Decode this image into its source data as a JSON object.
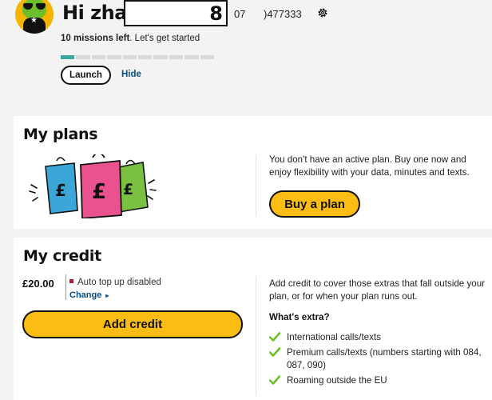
{
  "header": {
    "greeting": "Hi zha",
    "redacted_suffix": "8",
    "phone_prefix": "07",
    "phone_rest": ")477333",
    "missions_count": "10 missions left",
    "missions_suffix": ". Let's get started",
    "progress": {
      "completed": 1,
      "total": 10
    },
    "launch_label": "Launch",
    "hide_label": "Hide"
  },
  "plans": {
    "title": "My plans",
    "description": "You don't have an active plan. Buy one now and enjoy flexibility with your data, minutes and texts.",
    "buy_label": "Buy a plan"
  },
  "credit": {
    "title": "My credit",
    "amount": "£20.00",
    "topup_status": "Auto top up disabled",
    "change_label": "Change",
    "add_label": "Add credit",
    "description": "Add credit to cover those extras that fall outside your plan, or for when your plan runs out.",
    "extras_heading": "What's extra?",
    "extras": [
      "International calls/texts",
      "Premium calls/texts (numbers starting with 084, 087, 090)",
      "Roaming outside the EU"
    ]
  },
  "colors": {
    "accent_yellow": "#fbbd14",
    "link_blue": "#0a4d80",
    "progress_done": "#3aa7a0",
    "check_green": "#6cbf2a"
  }
}
